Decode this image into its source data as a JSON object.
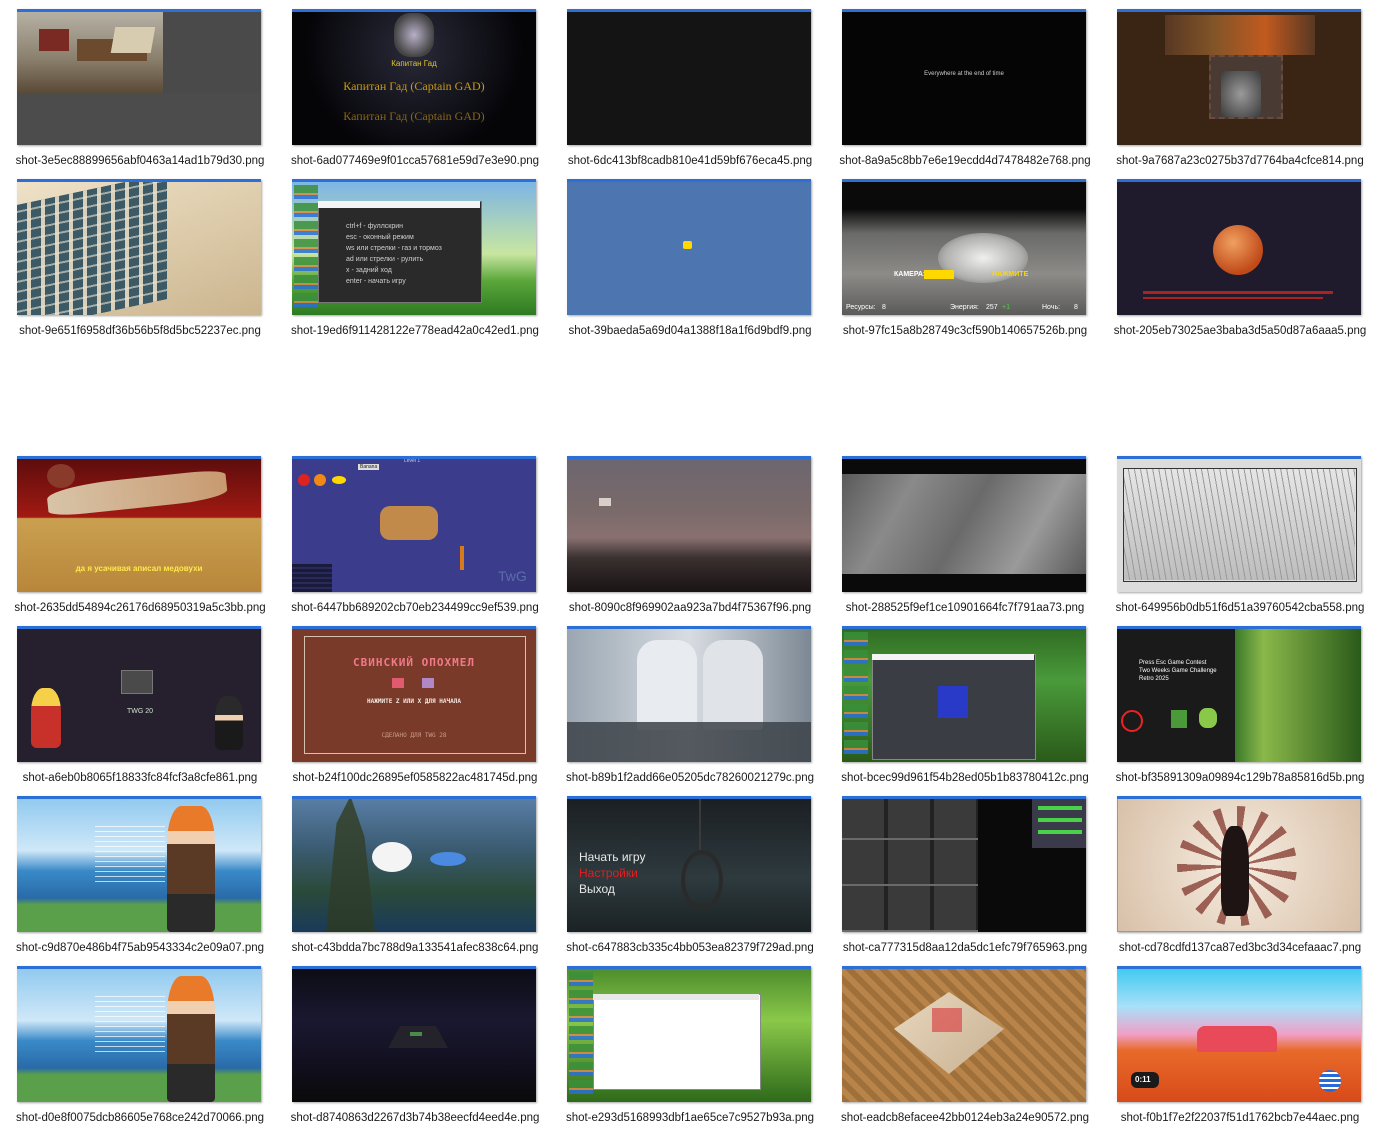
{
  "files": [
    {
      "name": "shot-3e5ec88899656abf0463a14ad1b79d30.png"
    },
    {
      "name": "shot-6ad077469e9f01cca57681e59d7e3e90.png",
      "texts": [
        "Капитан Гад",
        "Капитан Гад (Captain GAD)",
        "Капитан Гад (Captain GAD)"
      ]
    },
    {
      "name": "shot-6dc413bf8cadb810e41d59bf676eca45.png"
    },
    {
      "name": "shot-8a9a5c8bb7e6e19ecdd4d7478482e768.png",
      "texts": [
        "Everywhere at the end of time"
      ]
    },
    {
      "name": "shot-9a7687a23c0275b37d7764ba4cfce814.png"
    },
    {
      "name": "shot-9e651f6958df36b56b5f8d5bc52237ec.png"
    },
    {
      "name": "shot-19ed6f911428122e778ead42a0c42ed1.png",
      "texts": [
        "ctrl+f - фуллскрин",
        "esc - оконный режим",
        "ws или стрелки - газ и тормоз",
        "ad или стрелки - рулить",
        "x - задний ход",
        "enter - начать игру"
      ]
    },
    {
      "name": "shot-39baeda5a69d04a1388f18a1f6d9bdf9.png"
    },
    {
      "name": "shot-97fc15a8b28749c3cf590b140657526b.png",
      "texts": [
        "КАМЕРА:",
        "НАЖМИТЕ",
        "Ресурсы:",
        "8",
        "Энергия:",
        "257",
        "+1",
        "Ночь:",
        "8"
      ]
    },
    {
      "name": "shot-205eb73025ae3baba3d5a50d87a6aaa5.png"
    },
    {
      "name": "shot-2635dd54894c26176d68950319a5c3bb.png",
      "texts": [
        "да я усачивая аписал медовухи"
      ]
    },
    {
      "name": "shot-6447bb689202cb70eb234499cc9ef539.png",
      "texts": [
        "Level 1",
        "Banana",
        "TwG"
      ]
    },
    {
      "name": "shot-8090c8f969902aa923a7bd4f75367f96.png"
    },
    {
      "name": "shot-288525f9ef1ce10901664fc7f791aa73.png"
    },
    {
      "name": "shot-649956b0db51f6d51a39760542cba558.png"
    },
    {
      "name": "shot-a6eb0b8065f18833fc84fcf3a8cfe861.png",
      "texts": [
        "TWG 20"
      ]
    },
    {
      "name": "shot-b24f100dc26895ef0585822ac481745d.png",
      "texts": [
        "СВИНСКИЙ ОПОХМЕЛ",
        "НАЖМИТЕ Z ИЛИ X ДЛЯ НАЧАЛА",
        "СДЕЛАНО ДЛЯ TWG 28"
      ]
    },
    {
      "name": "shot-b89b1f2add66e05205dc78260021279c.png"
    },
    {
      "name": "shot-bcec99d961f54b28ed05b1b83780412c.png"
    },
    {
      "name": "shot-bf35891309a09894c129b78a85816d5b.png",
      "texts": [
        "Press Esc Game Contest",
        "Two Weeks Game Challenge",
        "Retro 2025"
      ]
    },
    {
      "name": "shot-c9d870e486b4f75ab9543334c2e09a07.png"
    },
    {
      "name": "shot-c43bdda7bc788d9a133541afec838c64.png"
    },
    {
      "name": "shot-c647883cb335c4bb053ea82379f729ad.png",
      "texts": [
        "Начать игру",
        "Настройки",
        "Выход"
      ]
    },
    {
      "name": "shot-ca777315d8aa12da5dc1efc79f765963.png"
    },
    {
      "name": "shot-cd78cdfd137ca87ed3bc3d34cefaaac7.png"
    },
    {
      "name": "shot-d0e8f0075dcb86605e768ce242d70066.png"
    },
    {
      "name": "shot-d8740863d2267d3b74b38eecfd4eed4e.png"
    },
    {
      "name": "shot-e293d5168993dbf1ae65ce7c9527b93a.png"
    },
    {
      "name": "shot-eadcb8efacee42bb0124eb3a24e90572.png"
    },
    {
      "name": "shot-f0b1f7e2f22037f51d1762bcb7e44aec.png",
      "texts": [
        "0:11"
      ]
    }
  ],
  "colors": {
    "selection": "#2c6fd6",
    "caption": "#1a1a1a",
    "background": "#ffffff"
  }
}
